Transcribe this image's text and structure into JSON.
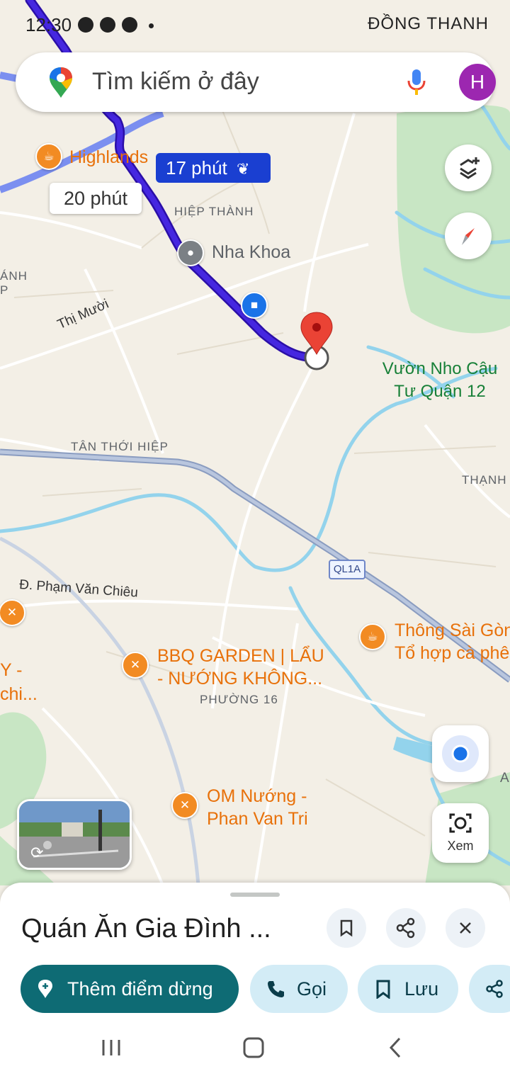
{
  "status_bar": {
    "time": "12:30",
    "right_text": "ĐỒNG THANH"
  },
  "search": {
    "placeholder": "Tìm kiếm ở đây",
    "avatar_letter": "H"
  },
  "map": {
    "areas": [
      "HIỆP THÀNH",
      "TÂN THỚI HIỆP",
      "THẠNH",
      "PHƯỜNG 16",
      "ÁNH",
      "P"
    ],
    "roads": [
      "Thị Mười",
      "Đ. Phạm Văn Chiêu"
    ],
    "route_labels": {
      "primary": "17 phút",
      "alternate": "20 phút"
    },
    "highway_shield": "QL1A",
    "pois": {
      "highlands": "Highlands",
      "nha_khoa": "Nha Khoa",
      "vuon_nho": "Vườn Nho Cậu Tư Quận 12",
      "thong_sai_gon": "Thông Sài Gòn",
      "to_hop": "Tổ hợp cà phê",
      "bbq_garden_1": "BBQ GARDEN | LẨU",
      "bbq_garden_2": "- NƯỚNG KHÔNG...",
      "om_nuong_1": "OM Nướng -",
      "om_nuong_2": "Phan Van Tri",
      "partial_y": "Y -",
      "partial_chi": "chi..."
    },
    "edge_letter": "A",
    "lens_label": "Xem"
  },
  "place": {
    "title": "Quán Ăn Gia Đình ...",
    "actions": {
      "add_stop": "Thêm điểm dừng",
      "call": "Gọi",
      "save": "Lưu"
    }
  },
  "colors": {
    "route": "#3d1ec2",
    "route_alt": "#7b8ff0",
    "water": "#8fd4ee",
    "park": "#c5e8c5",
    "accent": "#0e6b74"
  }
}
